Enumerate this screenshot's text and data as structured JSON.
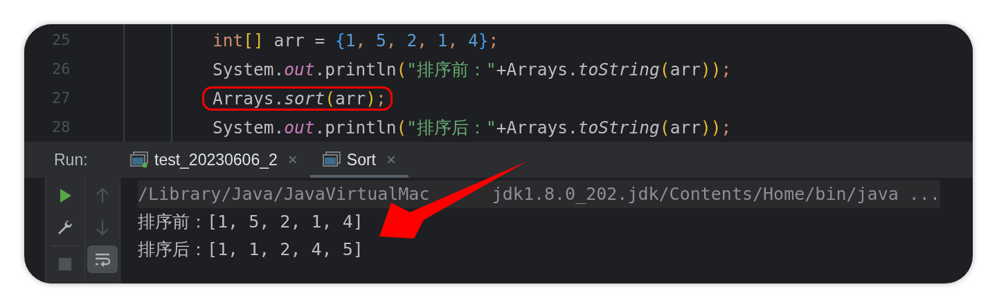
{
  "editor": {
    "lines": [
      {
        "number": "25",
        "highlighted": false,
        "tokens": [
          {
            "text": "int",
            "kind": "keyword"
          },
          {
            "text": "[]",
            "kind": "bracket"
          },
          {
            "text": " arr = ",
            "kind": "plain"
          },
          {
            "text": "{",
            "kind": "brace"
          },
          {
            "text": "1",
            "kind": "number"
          },
          {
            "text": ", ",
            "kind": "keyword"
          },
          {
            "text": "5",
            "kind": "number"
          },
          {
            "text": ", ",
            "kind": "keyword"
          },
          {
            "text": "2",
            "kind": "number"
          },
          {
            "text": ", ",
            "kind": "keyword"
          },
          {
            "text": "1",
            "kind": "number"
          },
          {
            "text": ", ",
            "kind": "keyword"
          },
          {
            "text": "4",
            "kind": "number"
          },
          {
            "text": "}",
            "kind": "brace"
          },
          {
            "text": ";",
            "kind": "keyword"
          }
        ]
      },
      {
        "number": "26",
        "highlighted": false,
        "tokens": [
          {
            "text": "System.",
            "kind": "plain"
          },
          {
            "text": "out",
            "kind": "field"
          },
          {
            "text": ".println",
            "kind": "plain"
          },
          {
            "text": "(",
            "kind": "bracket"
          },
          {
            "text": "\"排序前：\"",
            "kind": "string"
          },
          {
            "text": "+Arrays.",
            "kind": "plain"
          },
          {
            "text": "toString",
            "kind": "static"
          },
          {
            "text": "(",
            "kind": "paren"
          },
          {
            "text": "arr",
            "kind": "plain"
          },
          {
            "text": ")",
            "kind": "paren"
          },
          {
            "text": ")",
            "kind": "bracket"
          },
          {
            "text": ";",
            "kind": "keyword"
          }
        ]
      },
      {
        "number": "27",
        "highlighted": true,
        "tokens": [
          {
            "text": "Arrays.",
            "kind": "plain"
          },
          {
            "text": "sort",
            "kind": "static"
          },
          {
            "text": "(",
            "kind": "bracket"
          },
          {
            "text": "arr",
            "kind": "plain"
          },
          {
            "text": ")",
            "kind": "bracket"
          },
          {
            "text": ";",
            "kind": "keyword"
          }
        ]
      },
      {
        "number": "28",
        "highlighted": false,
        "tokens": [
          {
            "text": "System.",
            "kind": "plain"
          },
          {
            "text": "out",
            "kind": "field"
          },
          {
            "text": ".println",
            "kind": "plain"
          },
          {
            "text": "(",
            "kind": "bracket"
          },
          {
            "text": "\"排序后：\"",
            "kind": "string"
          },
          {
            "text": "+Arrays.",
            "kind": "plain"
          },
          {
            "text": "toString",
            "kind": "static"
          },
          {
            "text": "(",
            "kind": "paren"
          },
          {
            "text": "arr",
            "kind": "plain"
          },
          {
            "text": ")",
            "kind": "paren"
          },
          {
            "text": ")",
            "kind": "bracket"
          },
          {
            "text": ";",
            "kind": "keyword"
          }
        ]
      }
    ]
  },
  "run_panel": {
    "label": "Run:",
    "tabs": [
      {
        "label": "test_20230606_2",
        "close": "×",
        "selected": false,
        "running": true
      },
      {
        "label": "Sort",
        "close": "×",
        "selected": true,
        "running": false
      }
    ],
    "toolbar_left": [
      {
        "kind": "play",
        "disabled": false,
        "selected": false
      },
      {
        "kind": "wrench",
        "disabled": false,
        "selected": false
      },
      {
        "kind": "stop",
        "disabled": true,
        "selected": false
      }
    ],
    "toolbar_right": [
      {
        "kind": "up",
        "disabled": true,
        "selected": false
      },
      {
        "kind": "down",
        "disabled": true,
        "selected": false
      },
      {
        "kind": "wrap",
        "disabled": false,
        "selected": true
      }
    ],
    "console": [
      {
        "parts": [
          "/Library/Java/JavaVirtualMac",
          "jdk1.8.0_202.jdk/Contents/Home/bin/java ..."
        ],
        "kind": "command"
      },
      {
        "text": "排序前：[1, 5, 2, 1, 4]",
        "kind": "output"
      },
      {
        "text": "排序后：[1, 1, 2, 4, 5]",
        "kind": "output"
      }
    ]
  }
}
